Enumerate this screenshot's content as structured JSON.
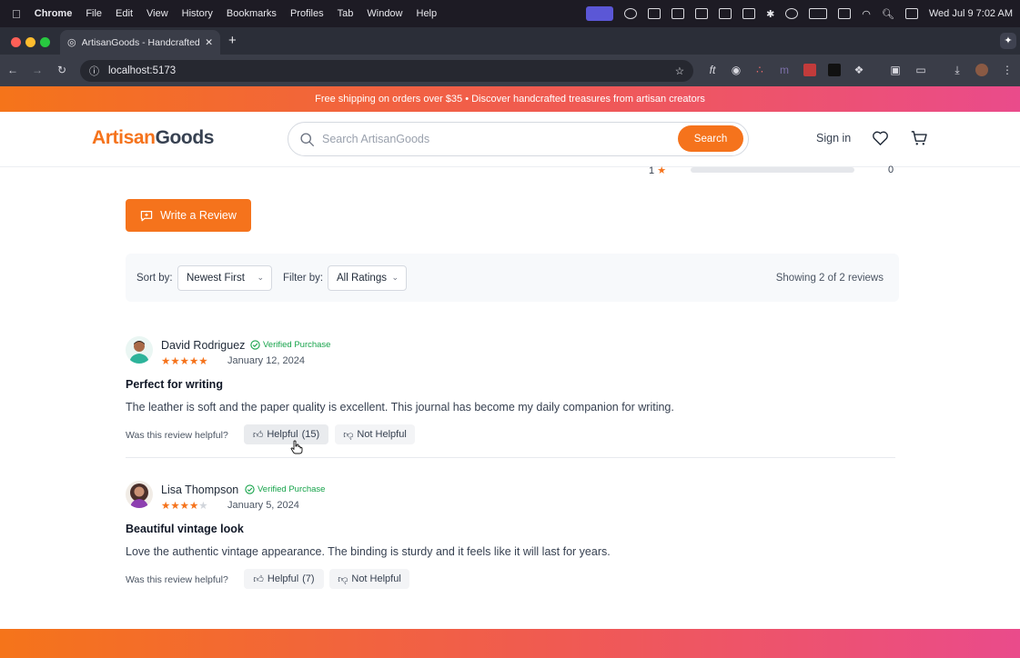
{
  "menubar": {
    "apple": "",
    "items": [
      "Chrome",
      "File",
      "Edit",
      "View",
      "History",
      "Bookmarks",
      "Profiles",
      "Tab",
      "Window",
      "Help"
    ],
    "datetime": "Wed Jul 9  7:02 AM"
  },
  "browser": {
    "tab_title": "ArtisanGoods - Handcrafted",
    "url": "localhost:5173"
  },
  "promo": {
    "text": "Free shipping on orders over $35 • Discover handcrafted treasures from artisan creators"
  },
  "header": {
    "logo_part1": "Artisan",
    "logo_part2": "Goods",
    "search_placeholder": "Search ArtisanGoods",
    "search_button": "Search",
    "sign_in": "Sign in"
  },
  "rating_breakdown": {
    "label": "1",
    "count": "0",
    "fraction": 0
  },
  "write_review": "Write a Review",
  "filters": {
    "sort_label": "Sort by:",
    "sort_value": "Newest First",
    "filter_label": "Filter by:",
    "filter_value": "All Ratings",
    "showing": "Showing 2 of 2 reviews"
  },
  "reviews": [
    {
      "name": "David Rodriguez",
      "verified": "Verified Purchase",
      "rating": 5,
      "date": "January 12, 2024",
      "title": "Perfect for writing",
      "body": "The leather is soft and the paper quality is excellent. This journal has become my daily companion for writing.",
      "helpful_question": "Was this review helpful?",
      "helpful_label": "Helpful",
      "helpful_count": "(15)",
      "not_helpful_label": "Not Helpful"
    },
    {
      "name": "Lisa Thompson",
      "verified": "Verified Purchase",
      "rating": 4,
      "date": "January 5, 2024",
      "title": "Beautiful vintage look",
      "body": "Love the authentic vintage appearance. The binding is sturdy and it feels like it will last for years.",
      "helpful_question": "Was this review helpful?",
      "helpful_label": "Helpful",
      "helpful_count": "(7)",
      "not_helpful_label": "Not Helpful"
    }
  ],
  "colors": {
    "accent": "#f5731c",
    "verified": "#16a34a",
    "banner_start": "#f5741a",
    "banner_end": "#ea4b8b"
  }
}
